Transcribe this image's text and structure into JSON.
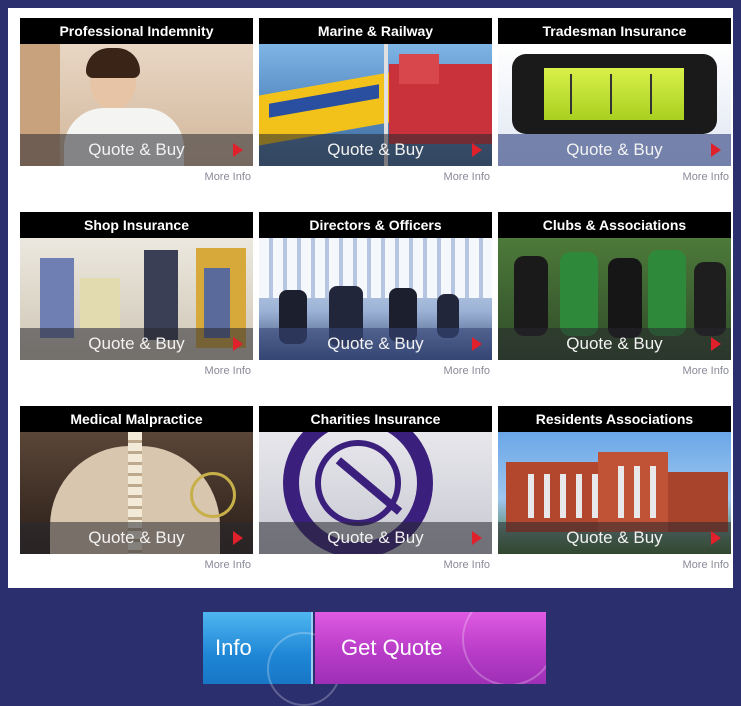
{
  "tiles": [
    {
      "title": "Professional Indemnity",
      "cta": "Quote & Buy",
      "more": "More Info"
    },
    {
      "title": "Marine & Railway",
      "cta": "Quote & Buy",
      "more": "More Info"
    },
    {
      "title": "Tradesman Insurance",
      "cta": "Quote & Buy",
      "more": "More Info"
    },
    {
      "title": "Shop Insurance",
      "cta": "Quote & Buy",
      "more": "More Info"
    },
    {
      "title": "Directors & Officers",
      "cta": "Quote & Buy",
      "more": "More Info"
    },
    {
      "title": "Clubs & Associations",
      "cta": "Quote & Buy",
      "more": "More Info"
    },
    {
      "title": "Medical Malpractice",
      "cta": "Quote & Buy",
      "more": "More Info"
    },
    {
      "title": "Charities Insurance",
      "cta": "Quote & Buy",
      "more": "More Info"
    },
    {
      "title": "Residents Associations",
      "cta": "Quote & Buy",
      "more": "More Info"
    }
  ],
  "footer": {
    "info_label": "Info",
    "quote_label": "Get Quote"
  },
  "colors": {
    "background": "#2b2f6e",
    "arrow": "#e0202a",
    "info_button": "#2a95de",
    "quote_button": "#c044cf"
  },
  "icons": {
    "arrow": "red-arrow-right-icon"
  }
}
